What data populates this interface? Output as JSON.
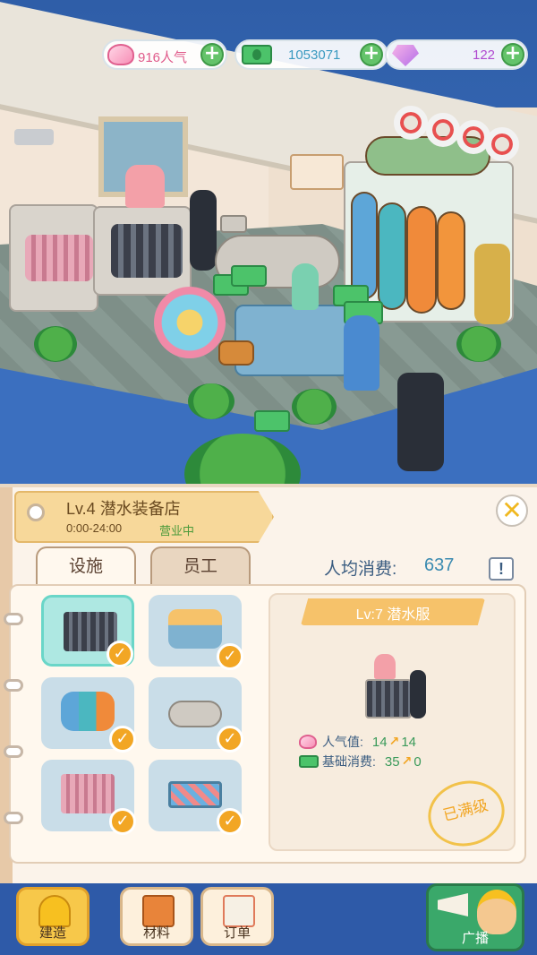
{
  "hud": {
    "popularity": "916人气",
    "money": "1053071",
    "gems": "122",
    "plus": "+"
  },
  "shop": {
    "title": "Lv.4 潜水装备店",
    "hours": "0:00-24:00",
    "status": "营业中"
  },
  "tabs": [
    {
      "label": "设施",
      "active": true
    },
    {
      "label": "员工",
      "active": false
    }
  ],
  "avg_spend": {
    "label": "人均消费:",
    "value": "637"
  },
  "info_icon": "!",
  "close_icon": "✕",
  "facilities": [
    {
      "icon": "wetsuit-rack-icon",
      "selected": true,
      "maxed": true
    },
    {
      "icon": "gear-table-icon",
      "selected": false,
      "maxed": true
    },
    {
      "icon": "surfboard-rack-icon",
      "selected": false,
      "maxed": true
    },
    {
      "icon": "cashier-counter-icon",
      "selected": false,
      "maxed": true
    },
    {
      "icon": "clothes-shelf-icon",
      "selected": false,
      "maxed": true
    },
    {
      "icon": "fish-painting-icon",
      "selected": false,
      "maxed": true
    }
  ],
  "detail": {
    "name": "Lv:7 潜水服",
    "popularity_label": "人气值:",
    "popularity_value": "14",
    "popularity_bonus": "14",
    "base_label": "基础消费:",
    "base_value": "35",
    "base_bonus": "0",
    "stamp": "已满级"
  },
  "nav": [
    {
      "label": "建造",
      "icon": "hard-hat-icon",
      "active": true
    },
    {
      "label": "材料",
      "icon": "material-box-icon",
      "active": false
    },
    {
      "label": "订单",
      "icon": "order-clipboard-icon",
      "active": false
    },
    {
      "label": "广播",
      "icon": "megaphone-icon",
      "active": false
    }
  ],
  "colors": {
    "accent_green": "#64c36a",
    "accent_orange": "#f2a624",
    "panel_bg": "#fbf3ea",
    "title_bg": "#f7d89a"
  }
}
